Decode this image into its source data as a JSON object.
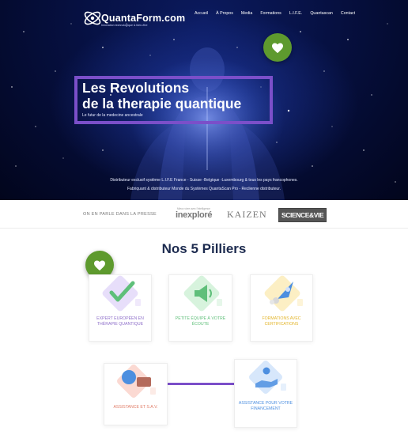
{
  "header": {
    "logo_text": "QuantaForm.com",
    "logo_subtext": "Innovation technologique & bien-être",
    "nav": [
      "Accueil",
      "À Propos",
      "Media",
      "Formations",
      "L.I.F.E.",
      "Quantascan",
      "Contact"
    ]
  },
  "hero": {
    "title_line1": "Les Revolutions",
    "title_line2": "de la therapie quantique",
    "subtitle": "Le futur de la medecine ancestrale",
    "distributor_line1": "Distributeur exclusif système L.I.F.E France - Suisse -Belgique -Luxembourg & tous les pays francophones.",
    "distributor_line2": "Fabriquant & distributeur Monde du Systèmes QuantaScan Pro - Reclienne distributeur."
  },
  "press": {
    "label": "ON EN PARLE DANS LA PRESSE",
    "logos": [
      "inexploré",
      "KAIZEN",
      "SCIENCE&VIE"
    ],
    "inexplore_tagline": "Mieux vivre avec l'intelligence"
  },
  "pillars": {
    "title": "Nos 5 Pilliers",
    "items": [
      {
        "label": "EXPERT EUROPÉEN EN THÉRAPIE QUANTIQUE",
        "icon": "check-icon",
        "color": "#8e6fc9",
        "bg": "#e7defa"
      },
      {
        "label": "PETITE ÉQUIPE À VOTRE ÉCOUTE",
        "icon": "megaphone-icon",
        "color": "#5fbf7a",
        "bg": "#d7f3dd"
      },
      {
        "label": "FORMATIONS AVEC CERTIFICATIONS",
        "icon": "rocket-icon",
        "color": "#e3b52b",
        "bg": "#fcefc4"
      },
      {
        "label": "ASSISTANCE ET S.A.V.",
        "icon": "chat-icon",
        "color": "#e07b66",
        "bg": "#fbd9d2"
      },
      {
        "label": "ASSISTANCE POUR VOTRE FINANCEMENT",
        "icon": "hand-money-icon",
        "color": "#4d8fe0",
        "bg": "#d7e7fb"
      }
    ]
  },
  "colors": {
    "accent_purple": "#7b4fc9",
    "badge_green": "#5e9a2e",
    "title_navy": "#1d2b4f"
  }
}
